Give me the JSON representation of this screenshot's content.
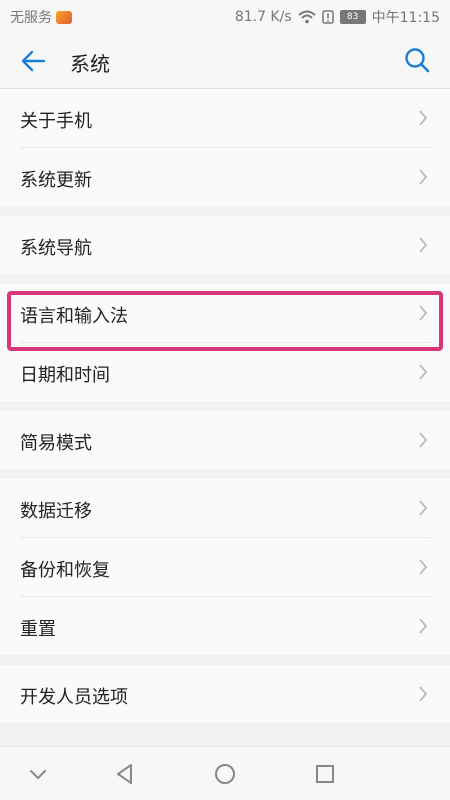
{
  "status_bar": {
    "carrier": "无服务",
    "speed": "81.7 K/s",
    "battery": "83",
    "time": "中午11:15"
  },
  "header": {
    "title": "系统",
    "back_icon": "back-arrow-icon",
    "search_icon": "search-icon"
  },
  "groups": [
    {
      "items": [
        "关于手机",
        "系统更新"
      ]
    },
    {
      "items": [
        "系统导航"
      ]
    },
    {
      "items": [
        "语言和输入法",
        "日期和时间"
      ]
    },
    {
      "items": [
        "简易模式"
      ]
    },
    {
      "items": [
        "数据迁移",
        "备份和恢复",
        "重置"
      ]
    },
    {
      "items": [
        "开发人员选项"
      ]
    }
  ],
  "highlighted_item": "语言和输入法",
  "nav_bar": {
    "icons": [
      "nav-down-icon",
      "nav-back-icon",
      "nav-home-icon",
      "nav-recents-icon"
    ]
  },
  "colors": {
    "accent": "#1a7fd6",
    "highlight": "#d8387a"
  }
}
